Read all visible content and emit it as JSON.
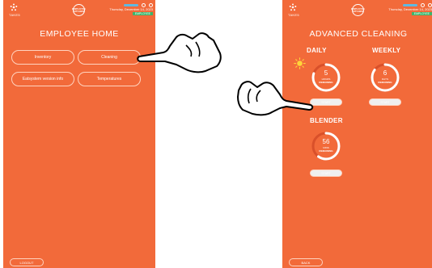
{
  "header": {
    "brand": "TAKE5",
    "logo_text": "EMPLOYEE\nKITCHEN",
    "date": "Thursday, December 14, 2023",
    "role": "EMPLOYEE"
  },
  "left_screen": {
    "title": "EMPLOYEE HOME",
    "buttons": [
      "Inventory",
      "Cleaning",
      "Eatsystem version info",
      "Temperatures"
    ],
    "logout": "LOGOUT"
  },
  "right_screen": {
    "title": "ADVANCED CLEANING",
    "daily": {
      "label": "DAILY",
      "value": "5",
      "unit": "HOURS",
      "remaining": "REMAINING",
      "fraction": 0.8,
      "start": "START"
    },
    "weekly": {
      "label": "WEEKLY",
      "value": "6",
      "unit": "DAYS",
      "remaining": "REMAINING",
      "fraction": 0.85,
      "start": "START"
    },
    "blender": {
      "label": "BLENDER",
      "value": "56",
      "unit": "MINS",
      "remaining": "REMAINING",
      "fraction": 0.6,
      "start": "START"
    },
    "back": "BACK"
  },
  "icons": [
    "take5-star-icon",
    "kitchen-logo-icon",
    "power-icon",
    "clock-icon",
    "sun-icon",
    "pointing-hand-icon"
  ],
  "colors": {
    "background": "#f26a3a",
    "accent_badge": "#3cb56b",
    "ring": "#ffffff"
  }
}
